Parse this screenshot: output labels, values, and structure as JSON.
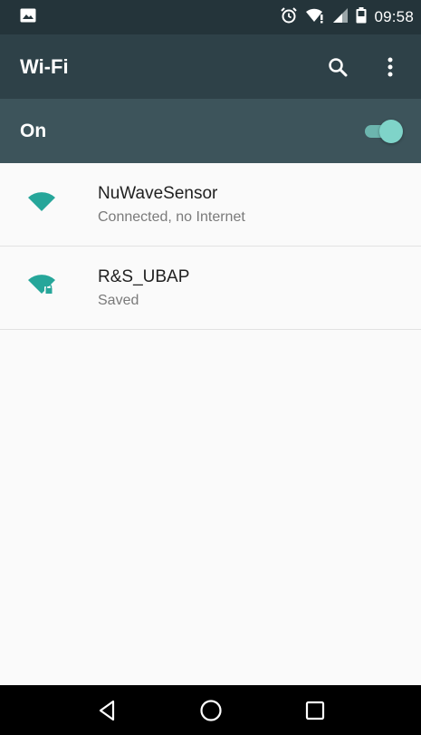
{
  "status_bar": {
    "time": "09:58",
    "icons": [
      "image-notification-icon",
      "alarm-icon",
      "wifi-signal-icon",
      "cell-signal-icon",
      "battery-icon"
    ]
  },
  "toolbar": {
    "title": "Wi-Fi",
    "search_icon": "search-icon",
    "menu_icon": "more-vert-icon"
  },
  "master_switch": {
    "label": "On",
    "state": true
  },
  "networks": [
    {
      "name": "NuWaveSensor",
      "status": "Connected, no Internet",
      "icon": "wifi-signal-icon"
    },
    {
      "name": "R&S_UBAP",
      "status": "Saved",
      "icon": "wifi-signal-secured-icon"
    }
  ],
  "nav_bar": {
    "buttons": [
      "back-icon",
      "home-icon",
      "recents-icon"
    ]
  },
  "colors": {
    "status_bar": "#24343a",
    "toolbar": "#2e4148",
    "switch_bar": "#3d545b",
    "accent": "#26a69a",
    "toggle_thumb": "#7fd4c9"
  }
}
